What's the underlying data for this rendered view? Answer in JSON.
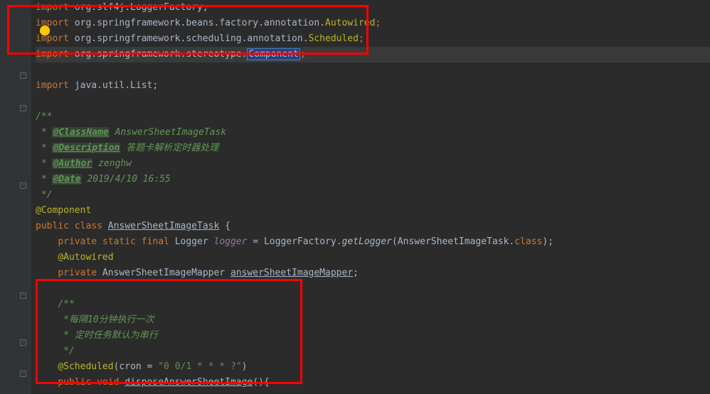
{
  "code": {
    "line1_import": "import",
    "line1_pkg": " org.slf4j.LoggerFactory;",
    "line2_import": "import",
    "line2_pkg": " org.springframework.beans.factory.annotation.",
    "line2_cls": "Autowired",
    "line3_import": "import",
    "line3_pkg": " org.springframework.scheduling.annotation.",
    "line3_cls": "Scheduled",
    "line4_import": "import",
    "line4_pkg": " org.springframework.stereotype.",
    "line4_cls": "Component",
    "line6_import": "import",
    "line6_pkg": " java.util.List;",
    "doc_start": "/**",
    "doc_l1_star": " * ",
    "doc_tag_classname": "@ClassName",
    "doc_classname_val": " AnswerSheetImageTask",
    "doc_tag_description": "@Description",
    "doc_description_val": " 答题卡解析定时器处理",
    "doc_tag_author": "@Author",
    "doc_author_val": " zenghw",
    "doc_tag_date": "@Date",
    "doc_date_val": " 2019/4/10 16:55",
    "doc_end": " */",
    "anno_component": "@Component",
    "class_public": "public",
    "class_class": "class",
    "class_name": "AnswerSheetImageTask",
    "class_brace": " {",
    "logger_private": "private",
    "logger_static": "static",
    "logger_final": "final",
    "logger_type": "Logger ",
    "logger_name": "logger",
    "logger_eq": " = LoggerFactory.",
    "logger_method": "getLogger",
    "logger_arg": "(AnswerSheetImageTask.",
    "logger_class_kw": "class",
    "logger_end": ");",
    "anno_autowired": "@Autowired",
    "mapper_private": "private",
    "mapper_type": " AnswerSheetImageMapper ",
    "mapper_name": "answerSheetImageMapper",
    "mapper_end": ";",
    "doc2_start": "/**",
    "doc2_l1": " *每隔10分钟执行一次",
    "doc2_l2": " * 定时任务默认为串行",
    "doc2_end": " */",
    "anno_scheduled": "@Scheduled",
    "scheduled_open": "(",
    "scheduled_attr": "cron",
    "scheduled_eq": " = ",
    "scheduled_val": "\"0 0/1 * * * ?\"",
    "scheduled_close": ")",
    "method_public": "public",
    "method_void": "void",
    "method_name": "disposeAnswerSheetImage",
    "method_sig": "(){"
  }
}
